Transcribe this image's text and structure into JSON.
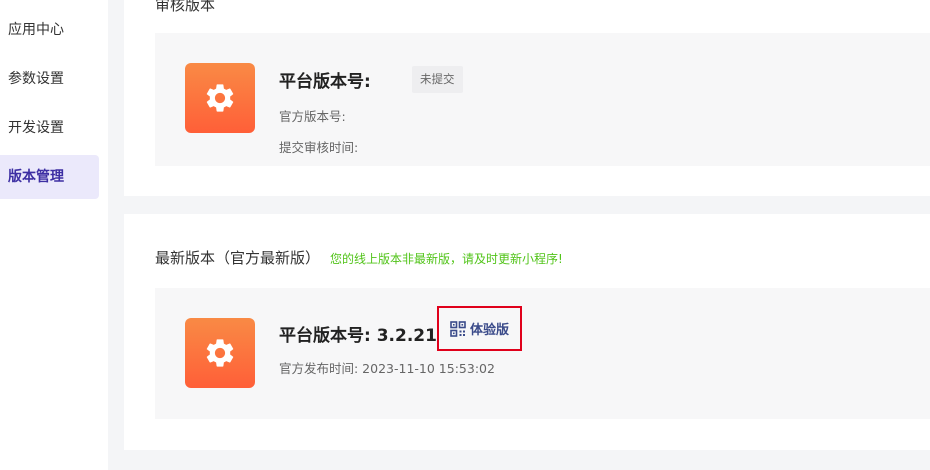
{
  "sidebar": {
    "items": [
      {
        "label": "应用中心"
      },
      {
        "label": "参数设置"
      },
      {
        "label": "开发设置"
      },
      {
        "label": "版本管理",
        "active": true
      }
    ]
  },
  "review": {
    "section_title": "审核版本",
    "platform_version_label": "平台版本号:",
    "status_badge": "未提交",
    "official_version_label": "官方版本号:",
    "submit_time_label": "提交审核时间:"
  },
  "latest": {
    "section_title": "最新版本（官方最新版）",
    "notice": "您的线上版本非最新版，请及时更新小程序!",
    "platform_version_label": "平台版本号: 3.2.21",
    "trial_label": "体验版",
    "release_time_label": "官方发布时间: 2023-11-10 15:53:02"
  },
  "colors": {
    "accent": "#3d2fa3",
    "icon_gradient_top": "#f98a45",
    "icon_gradient_bottom": "#ff5f38",
    "notice_green": "#52c41a",
    "highlight_red": "#e0001b"
  },
  "icons": {
    "app_icon": "gear-icon",
    "trial_icon": "qr-code-icon"
  }
}
